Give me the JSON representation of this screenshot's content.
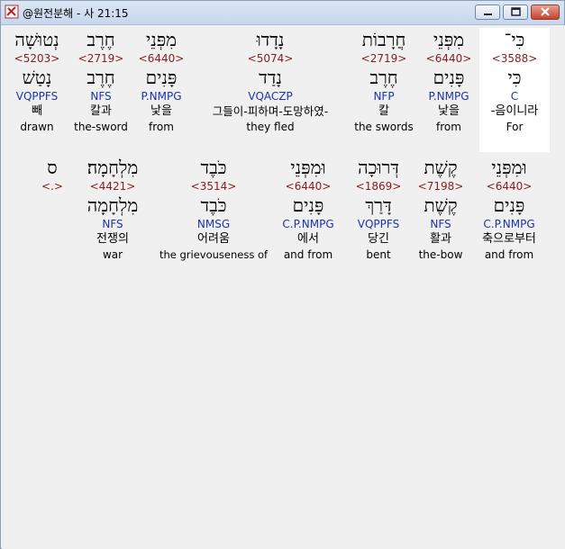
{
  "window": {
    "title": "@원전분해 - 사 21:15",
    "buttons": {
      "minimize": "minimize-icon",
      "maximize": "maximize-icon",
      "close": "close-icon"
    }
  },
  "colors": {
    "strong": "#8b1a1a",
    "morph": "#1a33b3",
    "text": "#000000",
    "highlight": "#ffffff"
  },
  "rows": [
    {
      "words": [
        {
          "heb": "כִּי־",
          "num": "<3588>",
          "lemma": "כִּי",
          "morph": "C",
          "kor": "-음이니라",
          "eng": "For",
          "selected": true
        },
        {
          "heb": "מִפְּנֵי",
          "num": "<6440>",
          "lemma": "פָּנִים",
          "morph": "P.NMPG",
          "kor": "낯을",
          "eng": "from"
        },
        {
          "heb": "חֲרָבוֹת",
          "num": "<2719>",
          "lemma": "חֶרֶב",
          "morph": "NFP",
          "kor": "칼",
          "eng": "the swords"
        },
        {
          "heb": "נָדָדוּ",
          "num": "<5074>",
          "lemma": "נָדַד",
          "morph": "VQACZP",
          "kor": "그들이-피하며-도망하였-",
          "eng": "they fled"
        },
        {
          "heb": "מִפְּנֵי",
          "num": "<6440>",
          "lemma": "פָּנִים",
          "morph": "P.NMPG",
          "kor": "낯을",
          "eng": "from"
        },
        {
          "heb": "חֶרֶב",
          "num": "<2719>",
          "lemma": "חֶרֶב",
          "morph": "NFS",
          "kor": "칼과",
          "eng": "the-sword"
        },
        {
          "heb": "נְטוּשָׁה",
          "num": "<5203>",
          "lemma": "נָטַשׁ",
          "morph": "VQPPFS",
          "kor": "빼",
          "eng": "drawn"
        }
      ]
    },
    {
      "words": [
        {
          "heb": "וּמִפְּנֵי",
          "num": "<6440>",
          "lemma": "פָּנִים",
          "morph": "C.P.NMPG",
          "kor": "축으로부터",
          "eng": "and from"
        },
        {
          "heb": "קֶשֶׁת",
          "num": "<7198>",
          "lemma": "קֶשֶׁת",
          "morph": "NFS",
          "kor": "활과",
          "eng": "the-bow"
        },
        {
          "heb": "דְּרוּכָה",
          "num": "<1869>",
          "lemma": "דָּרַךְ",
          "morph": "VQPPFS",
          "kor": "당긴",
          "eng": "bent"
        },
        {
          "heb": "וּמִפְּנֵי",
          "num": "<6440>",
          "lemma": "פָּנִים",
          "morph": "C.P.NMPG",
          "kor": "에서",
          "eng": "and from"
        },
        {
          "heb": "כֹּבֶד",
          "num": "<3514>",
          "lemma": "כֹּבֶד",
          "morph": "NMSG",
          "kor": "어려움",
          "eng": "the grievouseness of"
        },
        {
          "heb": "מִלְחָמָה׃",
          "num": "<4421>",
          "lemma": "מִלְחָמָה",
          "morph": "NFS",
          "kor": "전쟁의",
          "eng": "war"
        },
        {
          "heb": "ס",
          "num": "<.>",
          "lemma": "",
          "morph": "",
          "kor": "",
          "eng": ""
        }
      ]
    }
  ]
}
